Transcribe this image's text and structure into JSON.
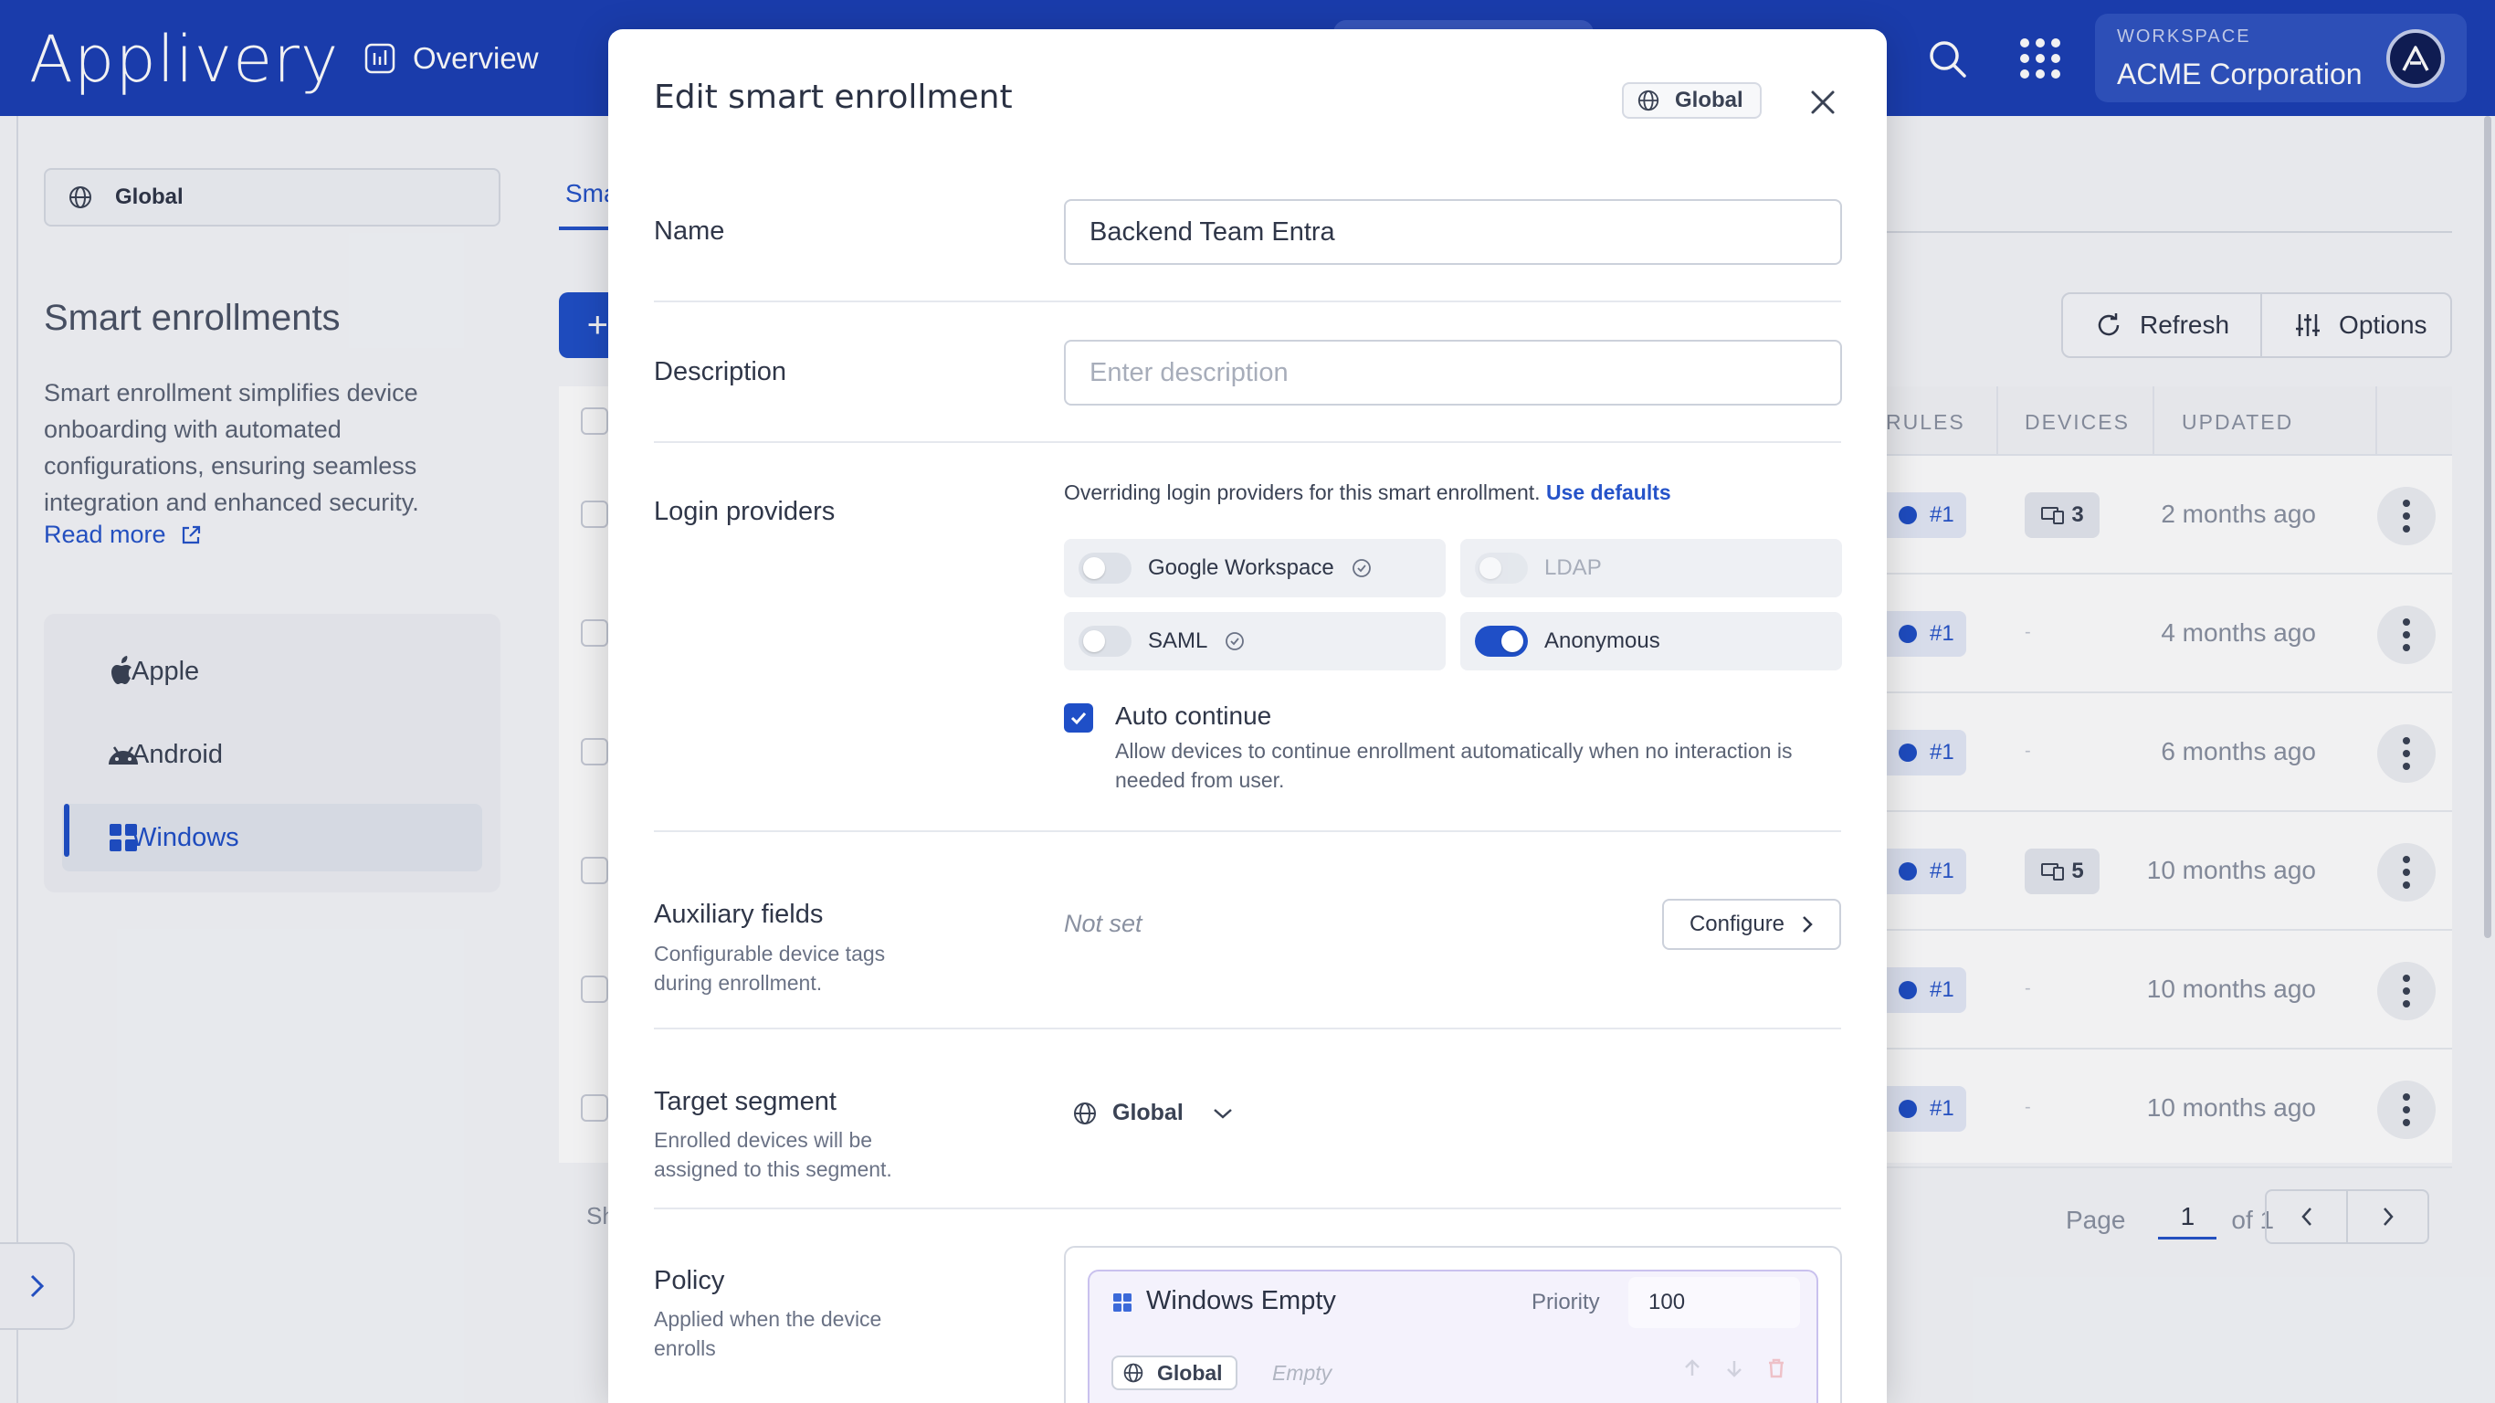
{
  "app": {
    "logo": "Applivery"
  },
  "topbar": {
    "nav_overview": "Overview",
    "workspace_label": "WORKSPACE",
    "workspace_name": "ACME Corporation"
  },
  "sidebar": {
    "segment": "Global",
    "title": "Smart enrollments",
    "description": "Smart enrollment simplifies device onboarding with automated configurations, ensuring seamless integration and enhanced security.",
    "read_more": "Read more",
    "platforms": [
      {
        "label": "Apple",
        "icon": "apple-icon",
        "active": false
      },
      {
        "label": "Android",
        "icon": "android-icon",
        "active": false
      },
      {
        "label": "Windows",
        "icon": "windows-icon",
        "active": true
      }
    ]
  },
  "main": {
    "tab": "Sma",
    "add_label": "+",
    "showing_text": "Sh",
    "toolbar": {
      "refresh": "Refresh",
      "options": "Options"
    },
    "columns": {
      "rules": "RULES",
      "devices": "DEVICES",
      "updated": "UPDATED"
    },
    "rows": [
      {
        "rule": "#1",
        "devices": "3",
        "updated": "2 months ago"
      },
      {
        "rule": "#1",
        "devices": "",
        "updated": "4 months ago"
      },
      {
        "rule": "#1",
        "devices": "",
        "updated": "6 months ago"
      },
      {
        "rule": "#1",
        "devices": "5",
        "updated": "10 months ago"
      },
      {
        "rule": "#1",
        "devices": "",
        "updated": "10 months ago"
      },
      {
        "rule": "#1",
        "devices": "",
        "updated": "10 months ago"
      }
    ],
    "empty_devices": "-",
    "pager": {
      "page_label": "Page",
      "page": "1",
      "of": "of 1"
    }
  },
  "modal": {
    "title": "Edit smart enrollment",
    "scope": "Global",
    "name": {
      "label": "Name",
      "value": "Backend Team Entra"
    },
    "description": {
      "label": "Description",
      "placeholder": "Enter description"
    },
    "login_providers": {
      "label": "Login providers",
      "note": "Overriding login providers for this smart enrollment.",
      "use_defaults": "Use defaults",
      "providers": [
        {
          "label": "Google Workspace",
          "on": false,
          "verified": true,
          "disabled": false
        },
        {
          "label": "LDAP",
          "on": false,
          "verified": false,
          "disabled": true
        },
        {
          "label": "SAML",
          "on": false,
          "verified": true,
          "disabled": false
        },
        {
          "label": "Anonymous",
          "on": true,
          "verified": false,
          "disabled": false
        }
      ],
      "auto_continue": {
        "label": "Auto continue",
        "checked": true,
        "description": "Allow devices to continue enrollment automatically when no interaction is needed from user."
      }
    },
    "auxiliary": {
      "label": "Auxiliary fields",
      "sub": "Configurable device tags during enrollment.",
      "value": "Not set",
      "configure": "Configure"
    },
    "target_segment": {
      "label": "Target segment",
      "sub": "Enrolled devices will be assigned to this segment.",
      "value": "Global"
    },
    "policy": {
      "label": "Policy",
      "sub": "Applied when the device enrolls",
      "name": "Windows Empty",
      "priority_label": "Priority",
      "priority": "100",
      "scope": "Global",
      "empty": "Empty"
    }
  },
  "colors": {
    "brand": "#1b3fb4",
    "accent": "#1f4fc7",
    "policy_border": "#c9c1ee"
  }
}
